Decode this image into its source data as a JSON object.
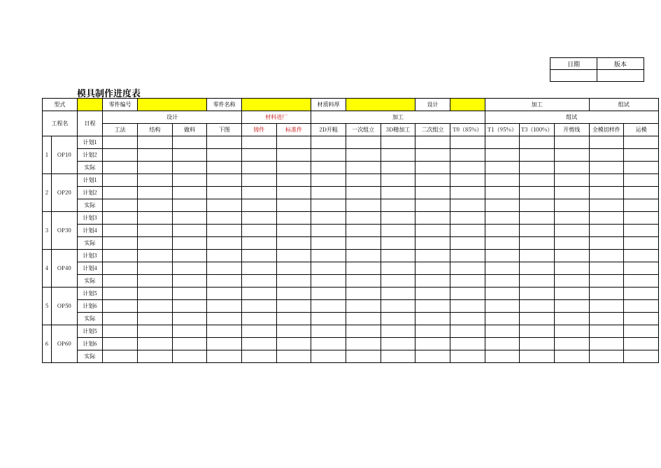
{
  "topbox": {
    "date_label": "日期",
    "version_label": "版本"
  },
  "title": "模具制作进度表",
  "meta_row": {
    "type_label": "型式",
    "part_no_label": "零件编号",
    "part_name_label": "零件名称",
    "material_label": "材质料厚",
    "design_label": "设计",
    "machining_label": "加工",
    "trial_label": "组试"
  },
  "header": {
    "process_label": "工程名",
    "schedule_label": "日程",
    "groups": {
      "design": "设计",
      "material": "材料进厂",
      "machining": "加工",
      "trial": "组试"
    },
    "cols": [
      {
        "k": "c1",
        "t": "工法"
      },
      {
        "k": "c2",
        "t": "结构"
      },
      {
        "k": "c3",
        "t": "做料"
      },
      {
        "k": "c4",
        "t": "下图"
      },
      {
        "k": "c5",
        "t": "铸件",
        "red": true
      },
      {
        "k": "c6",
        "t": "标准件",
        "red": true
      },
      {
        "k": "c7",
        "t": "2D开粗"
      },
      {
        "k": "c8",
        "t": "一次组立"
      },
      {
        "k": "c9",
        "t": "3D精加工"
      },
      {
        "k": "c10",
        "t": "二次组立"
      },
      {
        "k": "c11",
        "t": "T0（85%）"
      },
      {
        "k": "c12",
        "t": "T1（95%）"
      },
      {
        "k": "c13",
        "t": "T3（100%）"
      },
      {
        "k": "c14",
        "t": "开剪线"
      },
      {
        "k": "c15",
        "t": "全模切样件"
      },
      {
        "k": "c16",
        "t": "运模"
      }
    ]
  },
  "rows": {
    "plan1": "计划1",
    "plan2": "计划2",
    "plan3": "计划3",
    "plan4": "计划4",
    "plan5": "计划5",
    "plan6": "计划6",
    "actual": "实际"
  },
  "procs": [
    {
      "idx": "1",
      "name": "OP10",
      "r": [
        "plan1",
        "plan2",
        "actual"
      ]
    },
    {
      "idx": "2",
      "name": "OP20",
      "r": [
        "plan1",
        "plan2",
        "actual"
      ]
    },
    {
      "idx": "3",
      "name": "OP30",
      "r": [
        "plan3",
        "plan4",
        "actual"
      ]
    },
    {
      "idx": "4",
      "name": "OP40",
      "r": [
        "plan3",
        "plan4",
        "actual"
      ]
    },
    {
      "idx": "5",
      "name": "OP50",
      "r": [
        "plan5",
        "plan6",
        "actual"
      ]
    },
    {
      "idx": "6",
      "name": "OP60",
      "r": [
        "plan5",
        "plan6",
        "actual"
      ]
    }
  ]
}
